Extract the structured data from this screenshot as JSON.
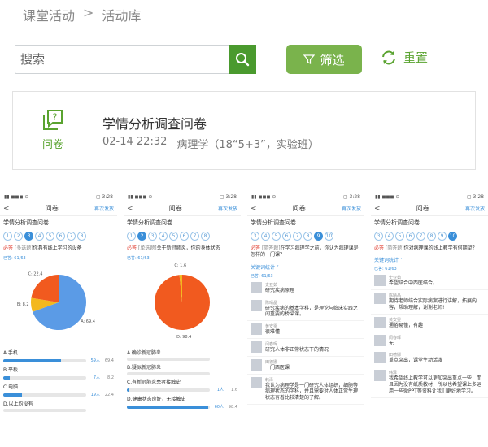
{
  "breadcrumb": {
    "parent": "课堂活动",
    "current": "活动库"
  },
  "search": {
    "placeholder": "搜索"
  },
  "toolbar": {
    "filter_label": "筛选",
    "reset_label": "重置"
  },
  "colors": {
    "accent_green": "#5aa330",
    "filter_bg": "#7ab34c",
    "link_blue": "#3a8fd9",
    "required_red": "#e03c2e"
  },
  "card": {
    "icon_label": "问卷",
    "title": "学情分析调查问卷",
    "date": "02-14 22:32",
    "course": "病理学（18“5+3”，实验班）"
  },
  "phones": [
    {
      "status": {
        "left": "▮▮ ◼◼◼ ⊙",
        "right": "▢ 3:28"
      },
      "header": {
        "back": "<",
        "title": "问卷",
        "right": "再次发放"
      },
      "survey_title": "学情分析调查问卷",
      "steps": [
        "1",
        "2",
        "3",
        "4",
        "5",
        "6",
        "7",
        "8"
      ],
      "active_step": 2,
      "question": {
        "required": "必答",
        "tag": "[多选题]",
        "text": "你具有线上学习的设备"
      },
      "done": "已答: 61/63",
      "pie": {
        "slices": [
          {
            "label": "A: 69.4",
            "value": 69.4,
            "color": "#5b9be6"
          },
          {
            "label": "B: 8.2",
            "value": 8.2,
            "color": "#f3b81d"
          },
          {
            "label": "C: 22.4",
            "value": 22.4,
            "color": "#f15a1f"
          }
        ]
      },
      "options": [
        {
          "label": "A.手机",
          "count": "59人",
          "pct": "69.4",
          "fill": 0.694
        },
        {
          "label": "B.平板",
          "count": "7人",
          "pct": "8.2",
          "fill": 0.082
        },
        {
          "label": "C.电脑",
          "count": "19人",
          "pct": "22.4",
          "fill": 0.224
        },
        {
          "label": "D.以上均没有",
          "count": "",
          "pct": "",
          "fill": 0
        }
      ]
    },
    {
      "status": {
        "left": "▮▮ ◼◼◼ ⊙",
        "right": "▢ 3:28"
      },
      "header": {
        "back": "<",
        "title": "问卷",
        "right": "再次发放"
      },
      "survey_title": "学情分析调查问卷",
      "steps": [
        "1",
        "2",
        "3",
        "4",
        "5",
        "6",
        "7",
        "8"
      ],
      "active_step": 1,
      "question": {
        "required": "必答",
        "tag": "[单选题]",
        "text": "关于新冠肺炎，你的身体状态"
      },
      "done": "已答: 61/63",
      "pie": {
        "slices": [
          {
            "label": "D: 98.4",
            "value": 98.4,
            "color": "#f15a1f"
          },
          {
            "label": "C: 1.6",
            "value": 1.6,
            "color": "#f3b81d"
          }
        ]
      },
      "options": [
        {
          "label": "A.确诊新冠肺炎",
          "count": "",
          "pct": "",
          "fill": 0
        },
        {
          "label": "B.疑似新冠肺炎",
          "count": "",
          "pct": "",
          "fill": 0
        },
        {
          "label": "C.有新冠肺炎患者接触史",
          "count": "1人",
          "pct": "1.6",
          "fill": 0.016
        },
        {
          "label": "D.健康状态良好，无接触史",
          "count": "60人",
          "pct": "98.4",
          "fill": 0.984
        }
      ]
    },
    {
      "status": {
        "left": "▮▮ ◼◼◼ ⊙",
        "right": "▢ 3:28"
      },
      "header": {
        "back": "<",
        "title": "问卷",
        "right": "再次发放"
      },
      "survey_title": "学情分析调查问卷",
      "steps": [
        "3",
        "4",
        "5",
        "6",
        "7",
        "8",
        "9",
        "10"
      ],
      "active_step": 6,
      "question": {
        "required": "必答",
        "tag": "[简答题]",
        "text": "在学习病理学之前，你认为病理课是怎样的一门课？"
      },
      "keyword": "关键词统计 ˅",
      "done": "已答: 61/63",
      "comments": [
        {
          "name": "史亚茹",
          "text": "研究疾病原理"
        },
        {
          "name": "陈晴晶",
          "text": "研究疾病的基本学科，是理论与临床实践之间重要的桥梁课。"
        },
        {
          "name": "黄安雯",
          "text": "很难懂"
        },
        {
          "name": "闫春晖",
          "text": "研究人体非正常状态下的情况"
        },
        {
          "name": "田德娜",
          "text": "一门西医课"
        },
        {
          "name": "韩泽",
          "text": "我认为病理学是一门研究人体组织，细胞等病理状态的学科，并且需要对人体正常生理状态有着比较清楚的了解。"
        }
      ]
    },
    {
      "status": {
        "left": "▮▮ ◼◼◼ ⊙",
        "right": "▢ 3:28"
      },
      "header": {
        "back": "<",
        "title": "问卷",
        "right": "再次发放"
      },
      "survey_title": "学情分析调查问卷",
      "steps": [
        "3",
        "4",
        "5",
        "6",
        "7",
        "8",
        "9",
        "10"
      ],
      "active_step": 7,
      "question": {
        "required": "必答",
        "tag": "[简答题]",
        "text": "你对病理课的线上教学有何期望？"
      },
      "keyword": "关键词统计 ˅",
      "done": "已答: 61/63",
      "comments": [
        {
          "name": "史亚茹",
          "text": "希望结合中西医结合。"
        },
        {
          "name": "陈晴晶",
          "text": "期待老师结合实际病案进行讲解，拓展内容，帮助理解，谢谢老师!"
        },
        {
          "name": "黄安雯",
          "text": "通俗易懂，有趣"
        },
        {
          "name": "闫春晖",
          "text": "无"
        },
        {
          "name": "田德娜",
          "text": "重点突出，课堂生动活泼"
        },
        {
          "name": "韩泽",
          "text": "我希望线上教学可以更加突出重点一些，而且因为没有纸质教材，所以也希望课上多运用一些微PPT等资料让我们更好地学习。"
        }
      ]
    }
  ]
}
